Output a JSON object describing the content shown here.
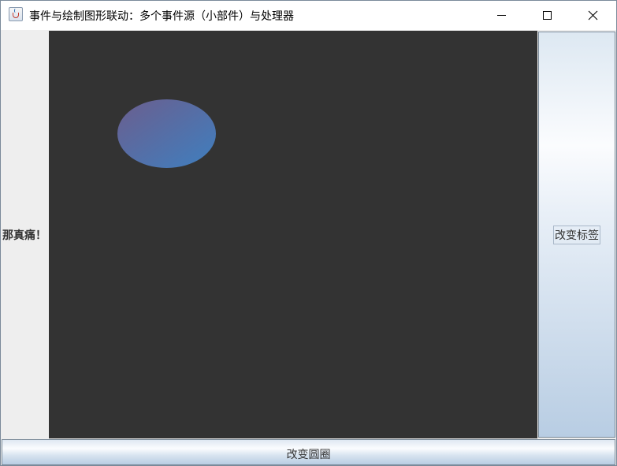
{
  "window": {
    "title": "事件与绘制图形联动：多个事件源（小部件）与处理器",
    "icon": "java-icon",
    "controls": [
      "minimize-icon",
      "maximize-icon",
      "close-icon"
    ]
  },
  "left_panel": {
    "label": "那真痛！"
  },
  "canvas": {
    "background_color": "#333333",
    "shape": "ellipse",
    "gradient_colors": [
      "#6b5e8e",
      "#3f7fbf"
    ]
  },
  "right_panel": {
    "button_label": "改变标签"
  },
  "bottom_panel": {
    "button_label": "改变圆圈"
  }
}
